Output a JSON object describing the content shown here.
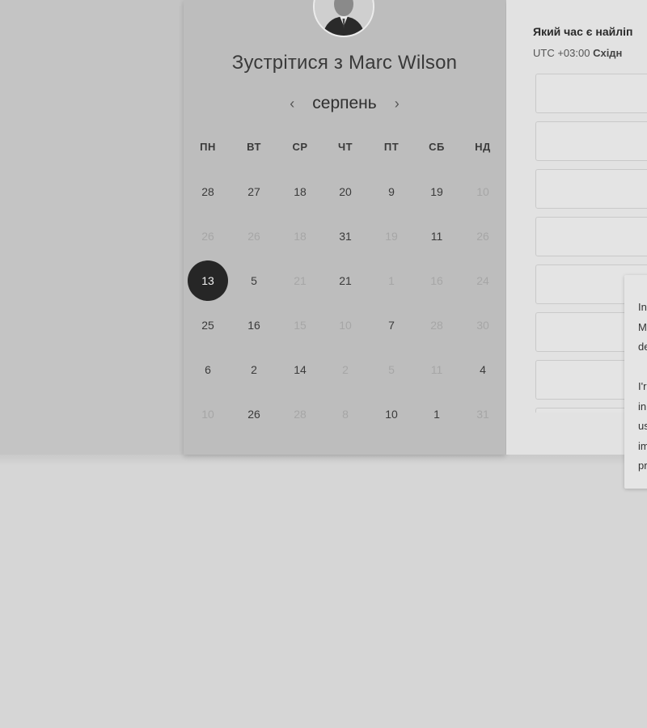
{
  "host": {
    "title": "Зустрітися з Marc Wilson",
    "avatar_icon": "person-avatar-icon"
  },
  "calendar": {
    "month": "серпень",
    "prev_icon": "chevron-left-icon",
    "next_icon": "chevron-right-icon",
    "weekdays": [
      "ПН",
      "ВТ",
      "СР",
      "ЧТ",
      "ПТ",
      "СБ",
      "НД"
    ],
    "weeks": [
      [
        {
          "d": "28",
          "muted": false
        },
        {
          "d": "27",
          "muted": false
        },
        {
          "d": "18",
          "muted": false
        },
        {
          "d": "20",
          "muted": false
        },
        {
          "d": "9",
          "muted": false
        },
        {
          "d": "19",
          "muted": false
        },
        {
          "d": "10",
          "muted": true
        }
      ],
      [
        {
          "d": "26",
          "muted": true
        },
        {
          "d": "26",
          "muted": true
        },
        {
          "d": "18",
          "muted": true
        },
        {
          "d": "31",
          "muted": false
        },
        {
          "d": "19",
          "muted": true
        },
        {
          "d": "11",
          "muted": false
        },
        {
          "d": "26",
          "muted": true
        }
      ],
      [
        {
          "d": "13",
          "muted": false,
          "selected": true
        },
        {
          "d": "5",
          "muted": false
        },
        {
          "d": "21",
          "muted": true
        },
        {
          "d": "21",
          "muted": false
        },
        {
          "d": "1",
          "muted": true
        },
        {
          "d": "16",
          "muted": true
        },
        {
          "d": "24",
          "muted": true
        }
      ],
      [
        {
          "d": "25",
          "muted": false
        },
        {
          "d": "16",
          "muted": false
        },
        {
          "d": "15",
          "muted": true
        },
        {
          "d": "10",
          "muted": true
        },
        {
          "d": "7",
          "muted": false
        },
        {
          "d": "28",
          "muted": true
        },
        {
          "d": "30",
          "muted": true
        }
      ],
      [
        {
          "d": "6",
          "muted": false
        },
        {
          "d": "2",
          "muted": false
        },
        {
          "d": "14",
          "muted": false
        },
        {
          "d": "2",
          "muted": true
        },
        {
          "d": "5",
          "muted": true
        },
        {
          "d": "11",
          "muted": true
        },
        {
          "d": "4",
          "muted": false
        }
      ],
      [
        {
          "d": "10",
          "muted": true
        },
        {
          "d": "26",
          "muted": false
        },
        {
          "d": "28",
          "muted": true
        },
        {
          "d": "8",
          "muted": true
        },
        {
          "d": "10",
          "muted": false
        },
        {
          "d": "1",
          "muted": false
        },
        {
          "d": "31",
          "muted": true
        }
      ]
    ]
  },
  "times": {
    "heading": "Який час є найліп",
    "tz_prefix": "UTC +03:00",
    "tz_name": "Східн",
    "slot_count": 8
  },
  "tooltip": {
    "lines": [
      "In",
      "M",
      "de",
      "",
      "I'r",
      "in",
      "us",
      "im",
      "pr"
    ]
  }
}
